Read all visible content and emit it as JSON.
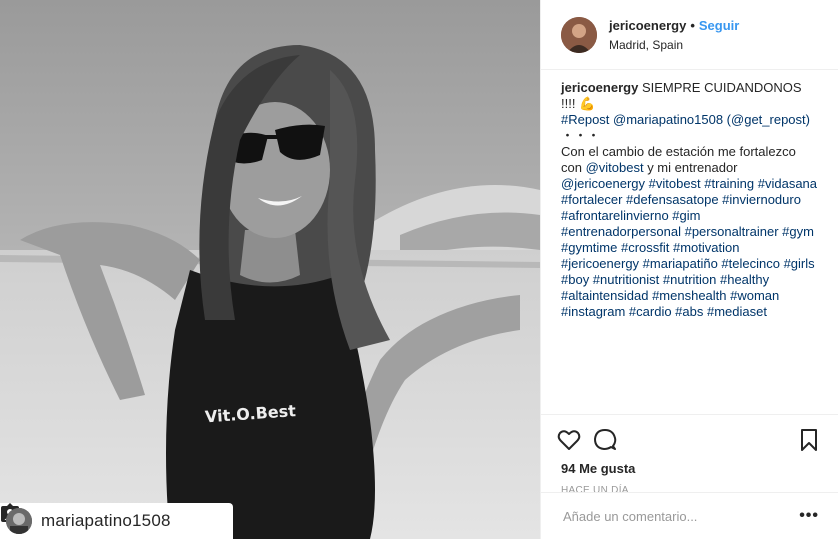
{
  "photo": {
    "description_icon": "person-tag-icon",
    "shirt_text": "Vit.O.Best",
    "repost_user": "mariapatino1508"
  },
  "header": {
    "username": "jericoenergy",
    "separator": "•",
    "follow_label": "Seguir",
    "location": "Madrid, Spain"
  },
  "caption": {
    "username": "jericoenergy",
    "line1": " SIEMPRE CUIDANDONOS !!!! 💪",
    "repost_line": "#Repost @mariapatino1508 (@get_repost)",
    "dots": "・・・",
    "text1": "Con el cambio de estación me fortalezco con ",
    "mention1": "@vitobest",
    "text2": " y mi entrenador ",
    "tags": "@jericoenergy #vitobest #training #vidasana #fortalecer #defensasatope #inviernoduro #afrontarelinvierno #gim #entrenadorpersonal #personaltrainer #gym #gymtime #crossfit #motivation #jericoenergy #mariapatiño #telecinco #girls #boy #nutritionist #nutrition #healthy #altaintensidad #menshealth #woman #instagram #cardio #abs #mediaset"
  },
  "actions": {
    "like_icon": "heart-icon",
    "comment_icon": "comment-bubble-icon",
    "save_icon": "bookmark-icon",
    "likes_text": "94 Me gusta",
    "time_text": "Hace un día"
  },
  "comment": {
    "placeholder": "Añade un comentario...",
    "more_label": "•••"
  },
  "colors": {
    "accent": "#3897f0",
    "hashtag": "#003569",
    "border": "#efefef",
    "muted": "#999999"
  }
}
